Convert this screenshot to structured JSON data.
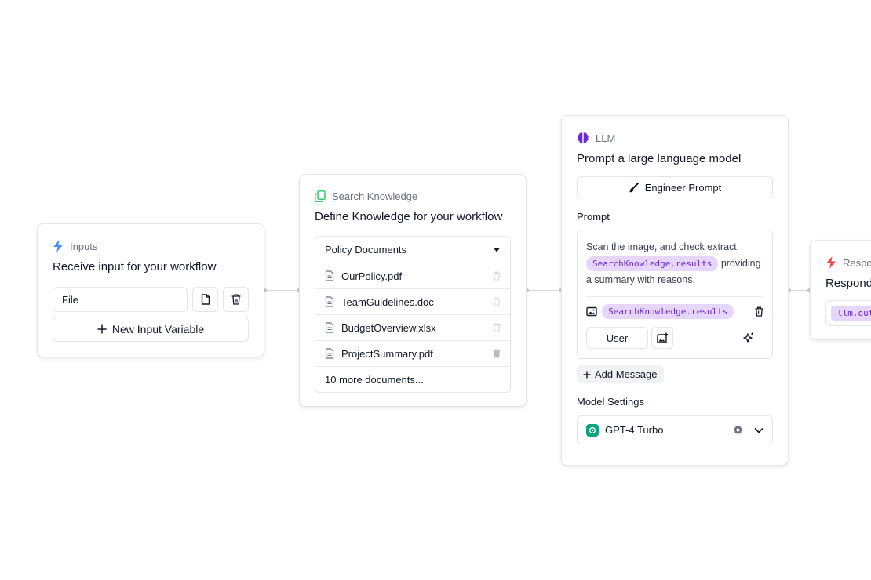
{
  "colors": {
    "inputs_accent": "#4f8df7",
    "knowledge_accent": "#22c55e",
    "llm_accent": "#6d28d9",
    "chip_bg": "#e7d6fb",
    "chip_text": "#6d28d9",
    "response_accent": "#ef4444",
    "gpt_green": "#10a37f"
  },
  "inputs_node": {
    "icon": "lightning-icon",
    "label": "Inputs",
    "title": "Receive input for your workflow",
    "field_value": "File",
    "new_variable_label": "New Input Variable"
  },
  "search_node": {
    "icon": "copy-documents-icon",
    "label": "Search Knowledge",
    "title": "Define Knowledge for your workflow",
    "dropdown_value": "Policy Documents",
    "documents": [
      {
        "name": "OurPolicy.pdf"
      },
      {
        "name": "TeamGuidelines.doc"
      },
      {
        "name": "BudgetOverview.xlsx"
      },
      {
        "name": "ProjectSummary.pdf"
      }
    ],
    "more_documents": "10 more documents..."
  },
  "llm_node": {
    "icon": "brain-icon",
    "label": "LLM",
    "title": "Prompt a large language model",
    "engineer_prompt_label": "Engineer Prompt",
    "prompt_label": "Prompt",
    "prompt_text_before": "Scan the image, and check extract",
    "prompt_chip": "SearchKnowledge.results",
    "prompt_text_after": "providing a summary with reasons.",
    "image_chip": "SearchKnowledge.results",
    "role_value": "User",
    "add_message_label": "Add Message",
    "model_settings_label": "Model Settings",
    "model_value": "GPT-4 Turbo"
  },
  "response_node": {
    "icon": "lightning-icon",
    "label": "Respo",
    "title": "Respond",
    "output_chip": "llm.out"
  }
}
